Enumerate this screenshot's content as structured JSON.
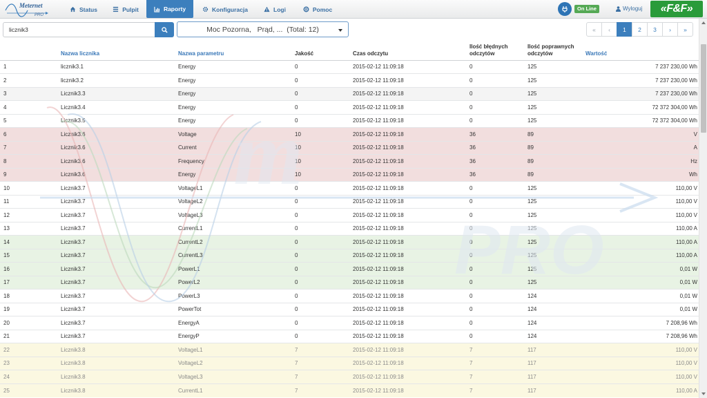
{
  "brand": {
    "logo_title": "Meternet",
    "logo_subtitle": "PRO",
    "partner_logo": "«F&F»"
  },
  "nav": {
    "tabs": [
      {
        "label": "Status",
        "icon": "home-icon"
      },
      {
        "label": "Pulpit",
        "icon": "list-icon"
      },
      {
        "label": "Raporty",
        "icon": "chart-icon",
        "active": true
      },
      {
        "label": "Konfiguracja",
        "icon": "gear-icon"
      },
      {
        "label": "Logi",
        "icon": "warning-icon"
      },
      {
        "label": "Pomoc",
        "icon": "lifebuoy-icon"
      }
    ],
    "status_badge": "On Line",
    "logout_label": "Wyloguj"
  },
  "toolbar": {
    "search_value": "licznik3",
    "param_select_value": "Moc Pozorna,   Prąd, ...  (Total: 12)"
  },
  "pagination": {
    "items": [
      "«",
      "‹",
      "1",
      "2",
      "3",
      "›",
      "»"
    ],
    "current": "1"
  },
  "table": {
    "headers": {
      "num": "",
      "meter": "Nazwa licznika",
      "param": "Nazwa parametru",
      "quality": "Jakość",
      "time": "Czas odczytu",
      "bad": "Ilość błędnych odczytów",
      "good": "Ilość poprawnych odczytów",
      "value": "Wartość"
    },
    "rows": [
      {
        "n": "1",
        "meter": "licznik3.1",
        "param": "Energy",
        "q": "0",
        "t": "2015-02-12 11:09:18",
        "bad": "0",
        "good": "125",
        "val": "7 237 230,00 Wh",
        "style": ""
      },
      {
        "n": "2",
        "meter": "licznik3.2",
        "param": "Energy",
        "q": "0",
        "t": "2015-02-12 11:09:18",
        "bad": "0",
        "good": "125",
        "val": "7 237 230,00 Wh",
        "style": ""
      },
      {
        "n": "3",
        "meter": "Licznik3.3",
        "param": "Energy",
        "q": "0",
        "t": "2015-02-12 11:09:18",
        "bad": "0",
        "good": "125",
        "val": "7 237 230,00 Wh",
        "style": "gray"
      },
      {
        "n": "4",
        "meter": "Licznik3.4",
        "param": "Energy",
        "q": "0",
        "t": "2015-02-12 11:09:18",
        "bad": "0",
        "good": "125",
        "val": "72 372 304,00 Wh",
        "style": ""
      },
      {
        "n": "5",
        "meter": "Licznik3.5",
        "param": "Energy",
        "q": "0",
        "t": "2015-02-12 11:09:18",
        "bad": "0",
        "good": "125",
        "val": "72 372 304,00 Wh",
        "style": ""
      },
      {
        "n": "6",
        "meter": "Licznik3.6",
        "param": "Voltage",
        "q": "10",
        "t": "2015-02-12 11:09:18",
        "bad": "36",
        "good": "89",
        "val": "V",
        "style": "red"
      },
      {
        "n": "7",
        "meter": "Licznik3.6",
        "param": "Current",
        "q": "10",
        "t": "2015-02-12 11:09:18",
        "bad": "36",
        "good": "89",
        "val": "A",
        "style": "red"
      },
      {
        "n": "8",
        "meter": "Licznik3.6",
        "param": "Frequency",
        "q": "10",
        "t": "2015-02-12 11:09:18",
        "bad": "36",
        "good": "89",
        "val": "Hz",
        "style": "red"
      },
      {
        "n": "9",
        "meter": "Licznik3.6",
        "param": "Energy",
        "q": "10",
        "t": "2015-02-12 11:09:18",
        "bad": "36",
        "good": "89",
        "val": "Wh",
        "style": "red"
      },
      {
        "n": "10",
        "meter": "Licznik3.7",
        "param": "VoltageL1",
        "q": "0",
        "t": "2015-02-12 11:09:18",
        "bad": "0",
        "good": "125",
        "val": "110,00 V",
        "style": ""
      },
      {
        "n": "11",
        "meter": "Licznik3.7",
        "param": "VoltageL2",
        "q": "0",
        "t": "2015-02-12 11:09:18",
        "bad": "0",
        "good": "125",
        "val": "110,00 V",
        "style": ""
      },
      {
        "n": "12",
        "meter": "Licznik3.7",
        "param": "VoltageL3",
        "q": "0",
        "t": "2015-02-12 11:09:18",
        "bad": "0",
        "good": "125",
        "val": "110,00 V",
        "style": ""
      },
      {
        "n": "13",
        "meter": "Licznik3.7",
        "param": "CurrentL1",
        "q": "0",
        "t": "2015-02-12 11:09:18",
        "bad": "0",
        "good": "125",
        "val": "110,00 A",
        "style": ""
      },
      {
        "n": "14",
        "meter": "Licznik3.7",
        "param": "CurrentL2",
        "q": "0",
        "t": "2015-02-12 11:09:18",
        "bad": "0",
        "good": "125",
        "val": "110,00 A",
        "style": "green"
      },
      {
        "n": "15",
        "meter": "Licznik3.7",
        "param": "CurrentL3",
        "q": "0",
        "t": "2015-02-12 11:09:18",
        "bad": "0",
        "good": "125",
        "val": "110,00 A",
        "style": "green"
      },
      {
        "n": "16",
        "meter": "Licznik3.7",
        "param": "PowerL1",
        "q": "0",
        "t": "2015-02-12 11:09:18",
        "bad": "0",
        "good": "125",
        "val": "0,01 W",
        "style": "green"
      },
      {
        "n": "17",
        "meter": "Licznik3.7",
        "param": "PowerL2",
        "q": "0",
        "t": "2015-02-12 11:09:18",
        "bad": "0",
        "good": "125",
        "val": "0,01 W",
        "style": "green"
      },
      {
        "n": "18",
        "meter": "Licznik3.7",
        "param": "PowerL3",
        "q": "0",
        "t": "2015-02-12 11:09:18",
        "bad": "0",
        "good": "124",
        "val": "0,01 W",
        "style": ""
      },
      {
        "n": "19",
        "meter": "Licznik3.7",
        "param": "PowerTot",
        "q": "0",
        "t": "2015-02-12 11:09:18",
        "bad": "0",
        "good": "124",
        "val": "0,01 W",
        "style": ""
      },
      {
        "n": "20",
        "meter": "Licznik3.7",
        "param": "EnergyA",
        "q": "0",
        "t": "2015-02-12 11:09:18",
        "bad": "0",
        "good": "124",
        "val": "7 208,96 Wh",
        "style": ""
      },
      {
        "n": "21",
        "meter": "Licznik3.7",
        "param": "EnergyP",
        "q": "0",
        "t": "2015-02-12 11:09:18",
        "bad": "0",
        "good": "124",
        "val": "7 208,96 Wh",
        "style": ""
      },
      {
        "n": "22",
        "meter": "Licznik3.8",
        "param": "VoltageL1",
        "q": "7",
        "t": "2015-02-12 11:09:18",
        "bad": "7",
        "good": "117",
        "val": "110,00 V",
        "style": "yellow dim"
      },
      {
        "n": "23",
        "meter": "Licznik3.8",
        "param": "VoltageL2",
        "q": "7",
        "t": "2015-02-12 11:09:18",
        "bad": "7",
        "good": "117",
        "val": "110,00 V",
        "style": "yellow dim"
      },
      {
        "n": "24",
        "meter": "Licznik3.8",
        "param": "VoltageL3",
        "q": "7",
        "t": "2015-02-12 11:09:18",
        "bad": "7",
        "good": "117",
        "val": "110,00 V",
        "style": "yellow dim"
      },
      {
        "n": "25",
        "meter": "Licznik3.8",
        "param": "CurrentL1",
        "q": "7",
        "t": "2015-02-12 11:09:18",
        "bad": "7",
        "good": "117",
        "val": "110,00 A",
        "style": "yellow dim"
      }
    ]
  },
  "colors": {
    "accent": "#3c7fbd",
    "online": "#55a955",
    "error_row": "#f2dede",
    "ok_row": "#e8f3e4",
    "warn_row": "#fbf8e1",
    "partner_green": "#2a9b3a"
  }
}
